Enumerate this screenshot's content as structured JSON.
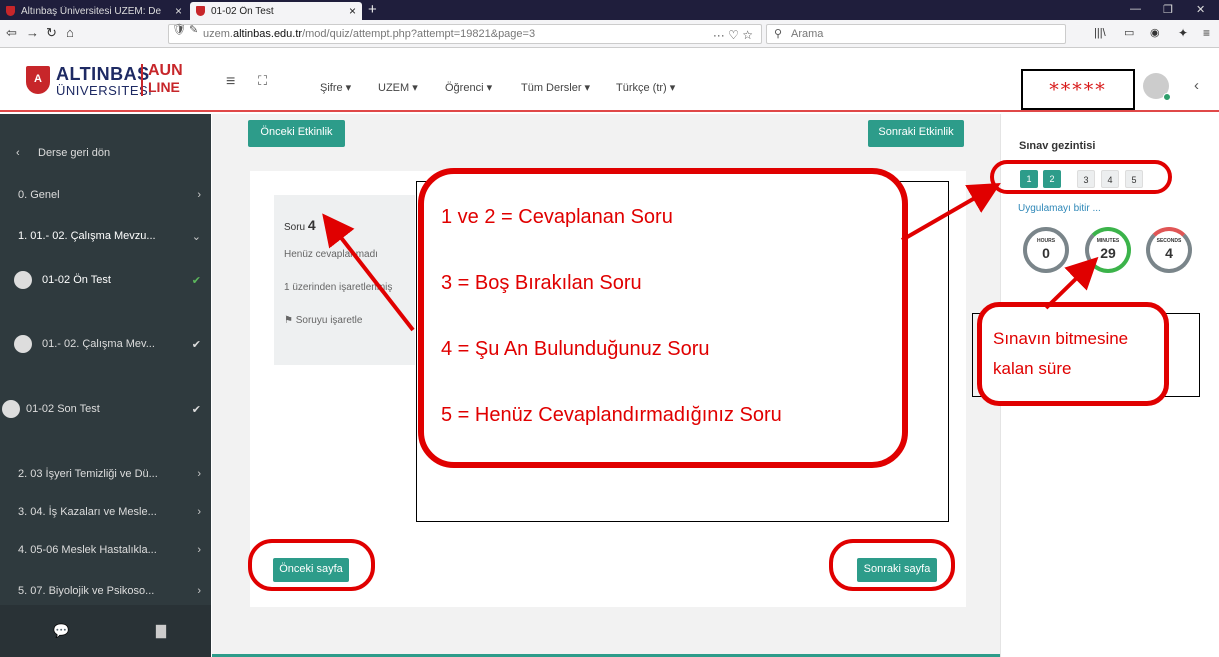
{
  "browser": {
    "tabs": [
      {
        "title": "Altınbaş Üniversitesi UZEM: De"
      },
      {
        "title": "01-02 Ön Test"
      }
    ],
    "url_prefix": "uzem.",
    "url_domain": "altinbas.edu.tr",
    "url_path": "/mod/quiz/attempt.php?attempt=19821&page=3",
    "search_placeholder": "Arama",
    "url_more": "···"
  },
  "header": {
    "logo_line1": "ALTINBAS",
    "logo_line2": "ÜNIVERSITESI",
    "logo_aun": "AUN",
    "logo_line": "LINE",
    "menu": [
      {
        "label": "Şifre ▾"
      },
      {
        "label": "UZEM ▾"
      },
      {
        "label": "Öğrenci ▾"
      },
      {
        "label": "Tüm Dersler ▾"
      },
      {
        "label": "Türkçe (tr) ▾"
      }
    ],
    "masked_user": "*****"
  },
  "sidebar": {
    "back": "Derse geri dön",
    "items": [
      {
        "label": "0.   Genel"
      },
      {
        "label": "1.   01.- 02. Çalışma Mevzu..."
      },
      {
        "label": "01-02 Ön Test"
      },
      {
        "label": "01.- 02. Çalışma Mev..."
      },
      {
        "label": "01-02 Son Test"
      },
      {
        "label": "2.   03 İşyeri Temizliği ve Dü..."
      },
      {
        "label": "3.   04. İş Kazaları ve Mesle..."
      },
      {
        "label": "4.   05-06 Meslek Hastalıkla..."
      },
      {
        "label": "5.   07. Biyolojik ve Psikoso..."
      }
    ]
  },
  "main": {
    "prev_activity": "Önceki Etkinlik",
    "next_activity": "Sonraki Etkinlik",
    "question_label": "Soru",
    "question_number": "4",
    "status": "Henüz cevaplanmadı",
    "marks": "1 üzerinden işaretlenmiş",
    "flag": "Soruyu işaretle",
    "prev_page": "Önceki sayfa",
    "next_page": "Sonraki sayfa"
  },
  "quiz_nav": {
    "title": "Sınav gezintisi",
    "buttons": [
      {
        "label": "1",
        "state": "answered"
      },
      {
        "label": "2",
        "state": "answered"
      },
      {
        "label": "3",
        "state": "not-answered"
      },
      {
        "label": "4",
        "state": "current"
      },
      {
        "label": "5",
        "state": "not-answered"
      }
    ],
    "finish": "Uygulamayı bitir ..."
  },
  "timer": {
    "hours_label": "HOURS",
    "hours": "0",
    "minutes_label": "MINUTES",
    "minutes": "29",
    "seconds_label": "SECONDS",
    "seconds": "4"
  },
  "annotations": {
    "lines": [
      "1 ve 2 = Cevaplanan Soru",
      "3 = Boş Bırakılan Soru",
      "4 = Şu An Bulunduğunuz Soru",
      "5 = Henüz Cevaplandırmadığınız Soru"
    ],
    "time_note_line1": "Sınavın bitmesine",
    "time_note_line2": "kalan süre",
    "accent_color": "#e00000",
    "teal": "#2d9c8a"
  }
}
